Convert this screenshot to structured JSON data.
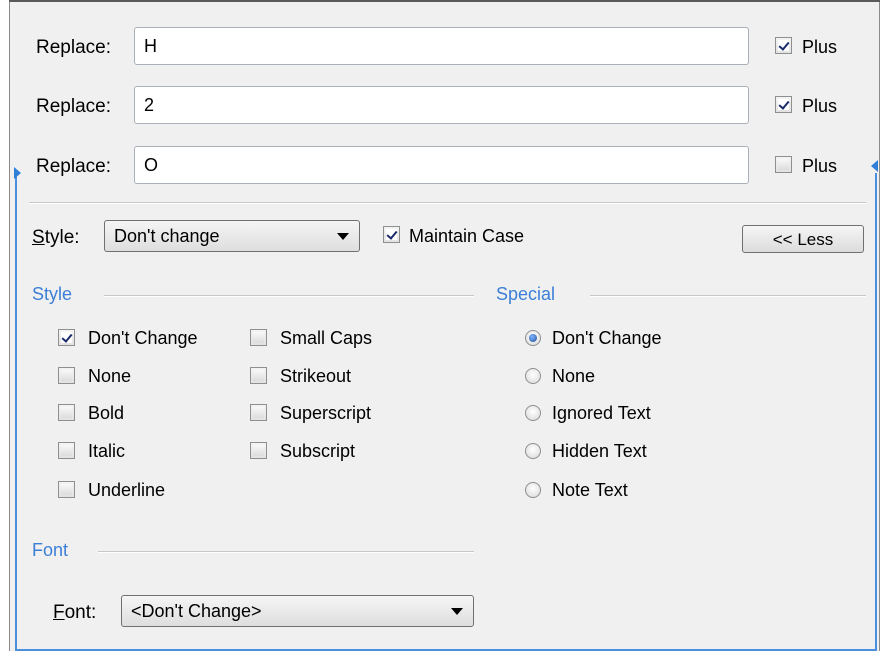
{
  "replace_rows": [
    {
      "label": "Replace:",
      "value": "H",
      "plus_label": "Plus",
      "plus_checked": true
    },
    {
      "label": "Replace:",
      "value": "2",
      "plus_label": "Plus",
      "plus_checked": true
    },
    {
      "label": "Replace:",
      "value": "O",
      "plus_label": "Plus",
      "plus_checked": false
    }
  ],
  "style_row": {
    "label_underlined": "S",
    "label_rest": "tyle:",
    "combo_value": "Don't change",
    "maintain_case_label": "Maintain Case",
    "maintain_case_checked": true,
    "less_button": "<< Less"
  },
  "style_group": {
    "title": "Style",
    "options_col1": [
      {
        "label": "Don't Change",
        "checked": true
      },
      {
        "label": "None",
        "checked": false
      },
      {
        "label": "Bold",
        "checked": false
      },
      {
        "label": "Italic",
        "checked": false
      },
      {
        "label": "Underline",
        "checked": false
      }
    ],
    "options_col2": [
      {
        "label": "Small Caps",
        "checked": false
      },
      {
        "label": "Strikeout",
        "checked": false
      },
      {
        "label": "Superscript",
        "checked": false
      },
      {
        "label": "Subscript",
        "checked": false
      }
    ]
  },
  "special_group": {
    "title": "Special",
    "options": [
      {
        "label": "Don't Change",
        "selected": true
      },
      {
        "label": "None",
        "selected": false
      },
      {
        "label": "Ignored Text",
        "selected": false
      },
      {
        "label": "Hidden Text",
        "selected": false
      },
      {
        "label": "Note Text",
        "selected": false
      }
    ]
  },
  "font_group": {
    "title": "Font",
    "label_underlined": "F",
    "label_rest": "ont:",
    "combo_value": "<Don't Change>"
  },
  "colors": {
    "accent_blue": "#3c7fd6",
    "panel_bg": "#f0f0f0"
  }
}
